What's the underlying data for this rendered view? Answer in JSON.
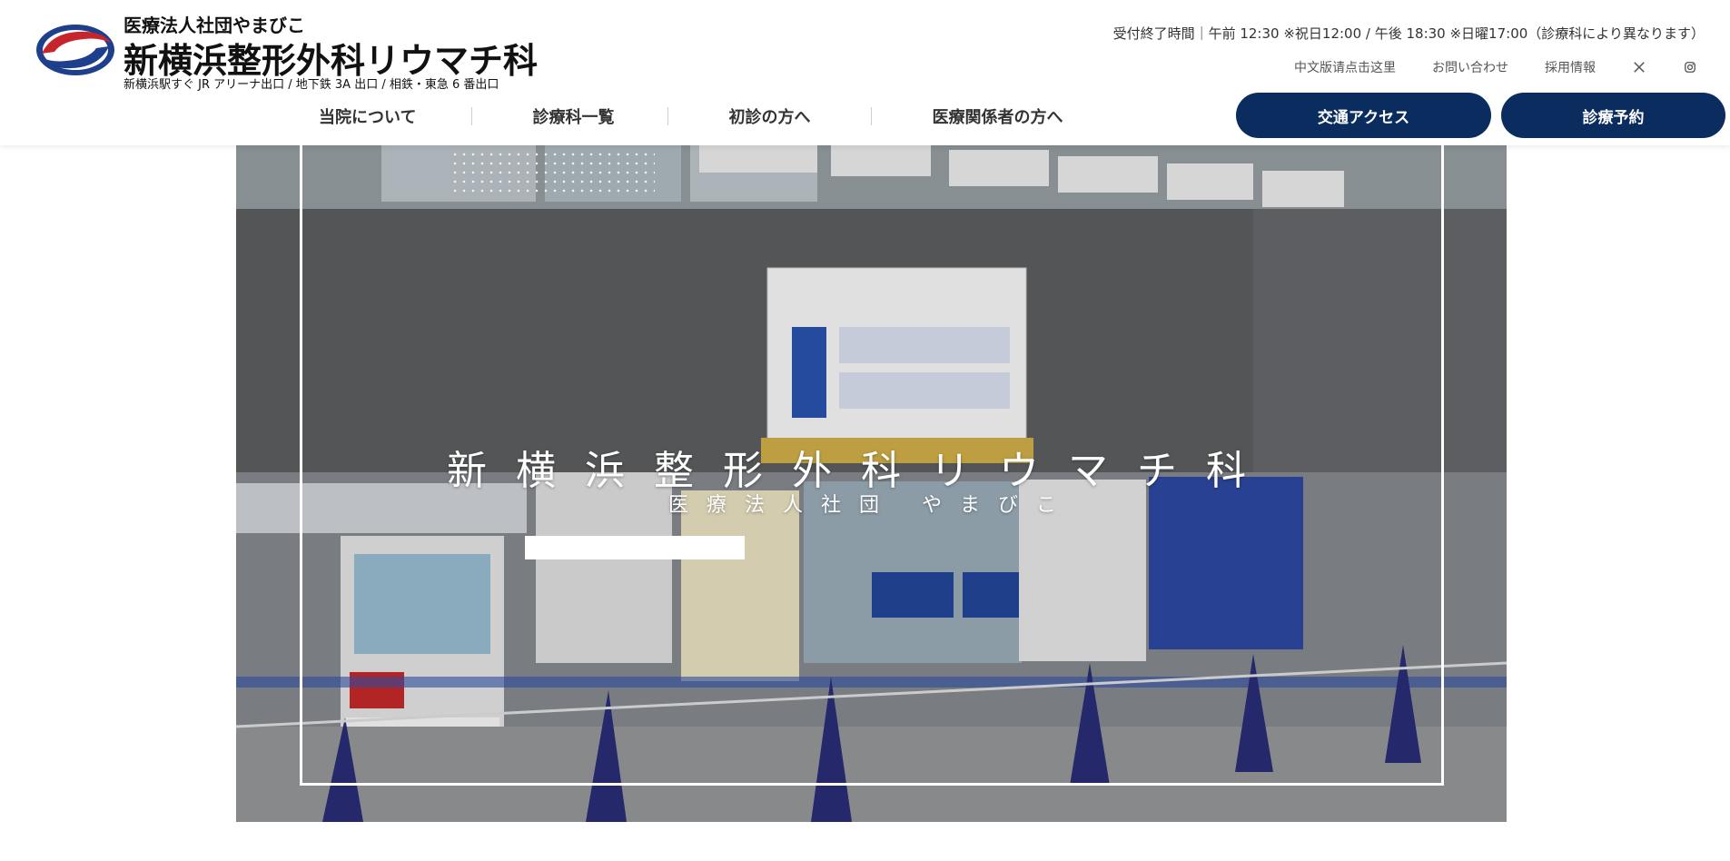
{
  "header": {
    "org_name": "医療法人社団やまびこ",
    "clinic_name": "新横浜整形外科リウマチ科",
    "access_line": "新横浜駅すぐ JR アリーナ出口 / 地下鉄 3A 出口 / 相鉄・東急 6 番出口",
    "hours": "受付終了時間｜午前 12:30 ※祝日12:00 / 午後 18:30 ※日曜17:00（診療科により異なります）",
    "util_links": {
      "chinese": "中文版请点击这里",
      "contact": "お問い合わせ",
      "recruit": "採用情報",
      "x_icon": "x-icon",
      "instagram_icon": "instagram-icon"
    },
    "nav": [
      "当院について",
      "診療科一覧",
      "初診の方へ",
      "医療関係者の方へ"
    ],
    "buttons": {
      "access": "交通アクセス",
      "reserve": "診療予約"
    },
    "colors": {
      "brand_navy": "#0b2c5f",
      "logo_red": "#c8242b",
      "logo_blue": "#1d3f8c"
    }
  },
  "hero": {
    "title": "新横浜整形外科リウマチ科",
    "subtitle": "医療法人社団 やまびこ"
  }
}
